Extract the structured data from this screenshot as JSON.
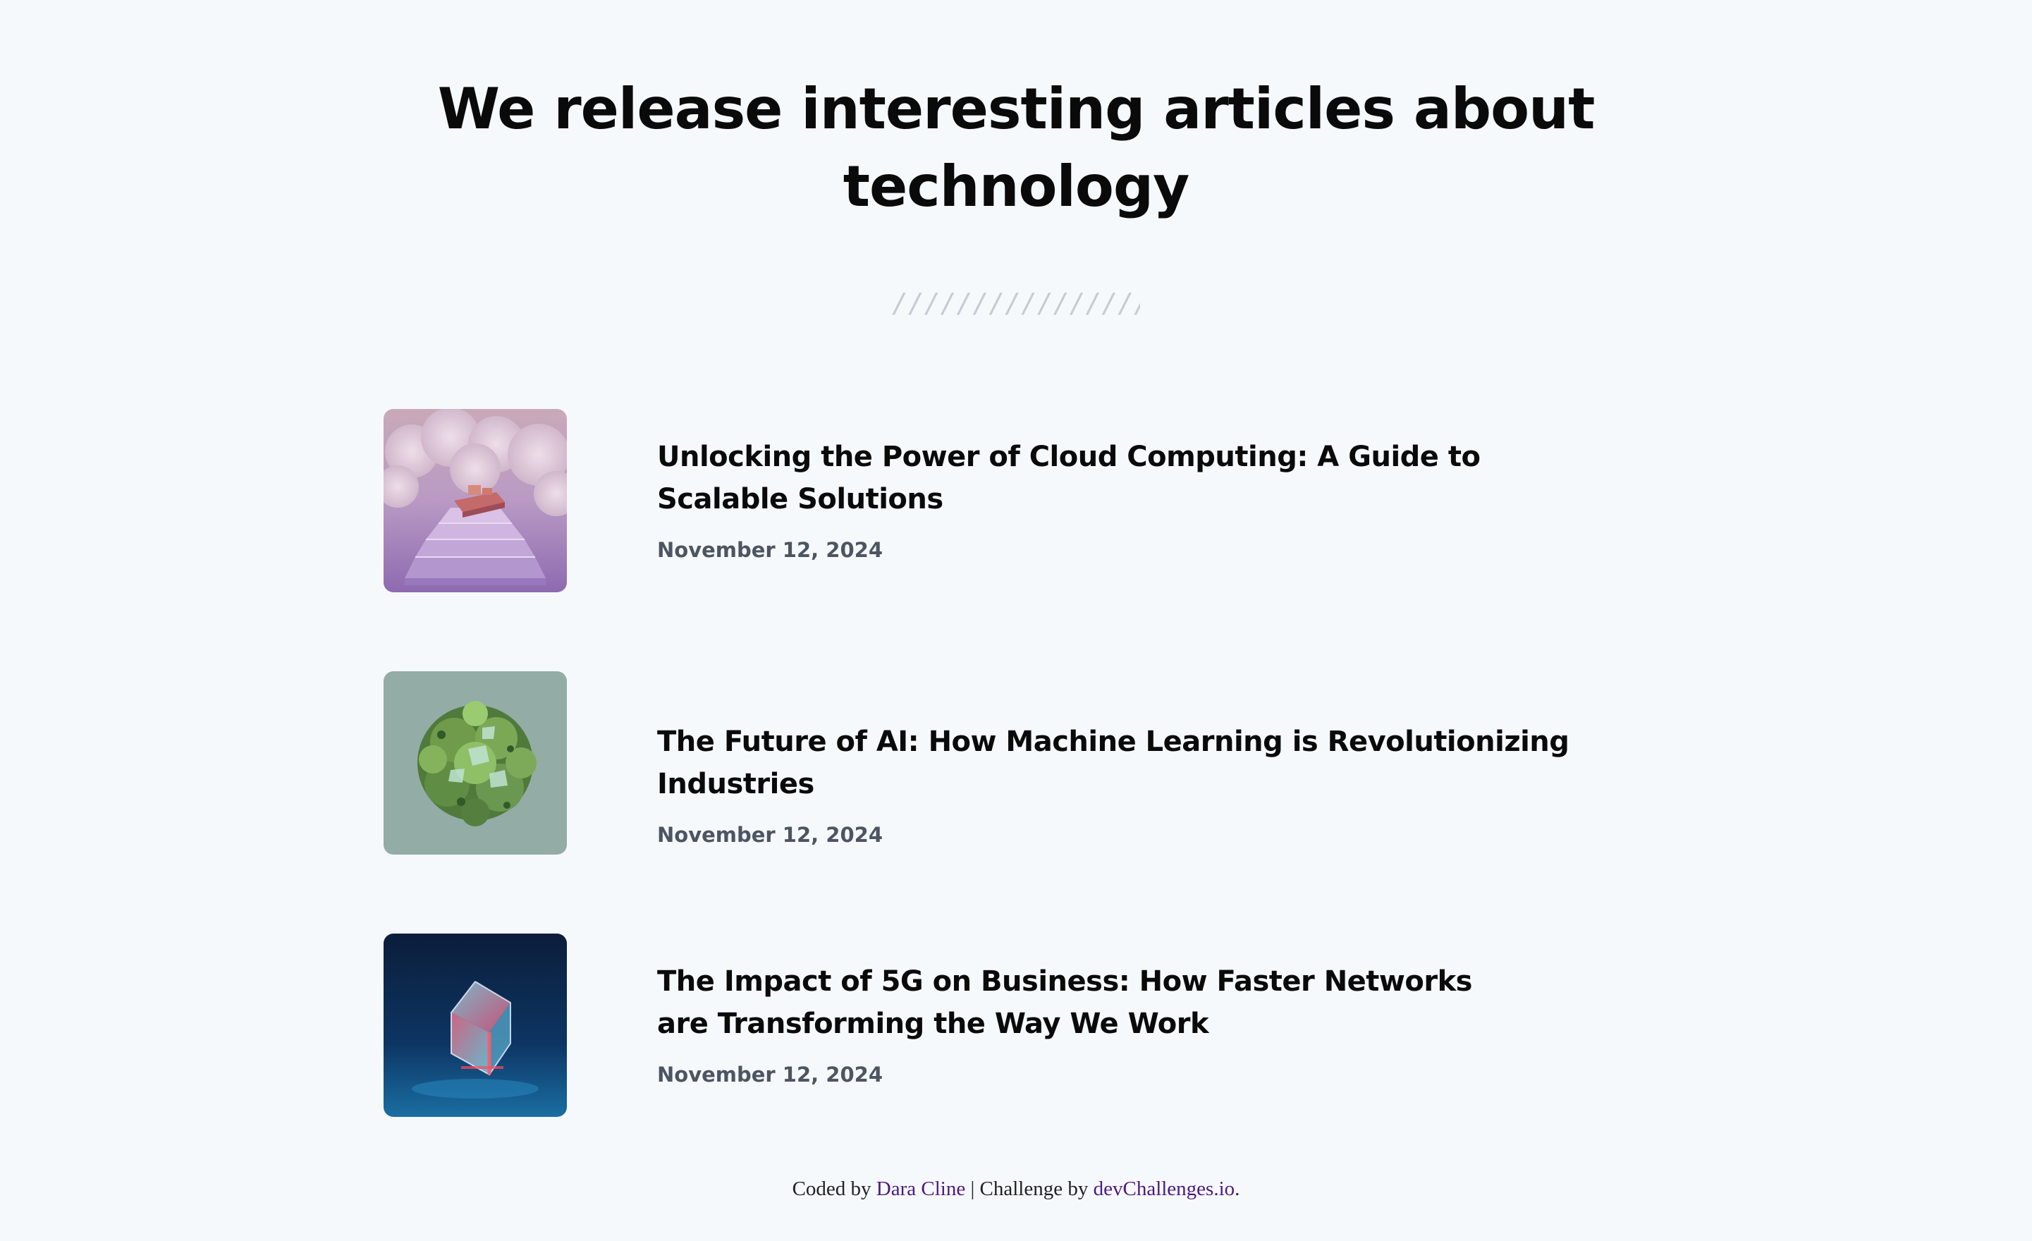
{
  "hero": {
    "title": "We release interesting articles about technology",
    "divider": "////////////////////"
  },
  "articles": [
    {
      "title": "Unlocking the Power of Cloud Computing: A Guide to Scalable Solutions",
      "date": "November 12, 2024",
      "image": "cloud-stairs-image"
    },
    {
      "title": "The Future of AI: How Machine Learning is Revolutionizing Industries",
      "date": "November 12, 2024",
      "image": "green-foliage-sphere-image"
    },
    {
      "title": "The Impact of 5G on Business: How Faster Networks are Transforming the Way We Work",
      "date": "November 12, 2024",
      "image": "glass-cube-image"
    }
  ],
  "footer": {
    "coded_by": "Coded by",
    "author": "Dara Cline",
    "separator": " | Challenge by",
    "challenge_site": "devChallenges.io",
    "end": "."
  },
  "colors": {
    "background": "#f6f9fc",
    "title": "#0a0a0a",
    "date": "#4d5562",
    "link": "#4d1a80",
    "divider": "#c7cbd3"
  }
}
